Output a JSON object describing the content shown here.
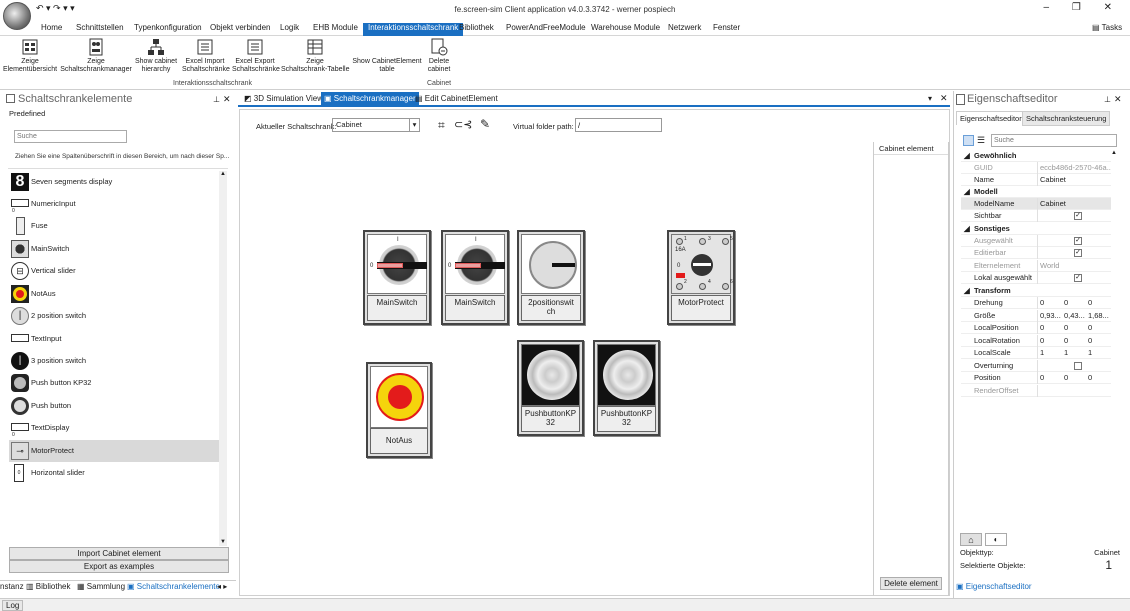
{
  "window": {
    "title": "fe.screen-sim Client application v4.0.3.3742 - werner pospiech",
    "controls": "– ❐ ✕"
  },
  "menu": [
    "Home",
    "Schnittstellen",
    "Typenkonfiguration",
    "Objekt verbinden",
    "Logik",
    "EHB Module",
    "Interaktionsschaltschrank",
    "Bibliothek",
    "PowerAndFreeModule",
    "Warehouse Module",
    "Netzwerk",
    "Fenster"
  ],
  "tasks_label": "Tasks",
  "ribbon": {
    "buttons": [
      {
        "label": "Zeige\nElementübersicht",
        "icon": "tree-icon"
      },
      {
        "label": "Zeige\nSchaltschrankmanager",
        "icon": "cabinet-manager-icon"
      },
      {
        "label": "Show cabinet\nhierarchy",
        "icon": "hierarchy-icon"
      },
      {
        "label": "Excel Import\nSchaltschränke",
        "icon": "excel-import-icon"
      },
      {
        "label": "Excel Export\nSchaltschränke",
        "icon": "excel-export-icon"
      },
      {
        "label": "Zeige\nSchaltschrank-Tabelle",
        "icon": "table-icon"
      },
      {
        "label": "Show CabinetElement\ntable",
        "icon": "table-icon"
      },
      {
        "label": "Delete\ncabinet",
        "icon": "delete-cabinet-icon"
      }
    ],
    "group1": "Interaktionsschaltschrank",
    "group2": "Cabinet"
  },
  "left": {
    "title": "Schaltschrankelemente",
    "subtitle": "Predefined",
    "search_placeholder": "Suche",
    "group_hint": "Ziehen Sie eine Spaltenüberschrift in diesen Bereich, um nach dieser Sp...",
    "items": [
      "Seven segments display",
      "NumericInput",
      "Fuse",
      "MainSwitch",
      "Vertical slider",
      "NotAus",
      "2 position switch",
      "TextInput",
      "3 position switch",
      "Push button KP32",
      "Push button",
      "TextDisplay",
      "MotorProtect",
      "Horizontal slider"
    ],
    "import_btn": "Import Cabinet element",
    "export_btn": "Export as examples",
    "bottom_tabs": [
      "nstanz",
      "Bibliothek",
      "Sammlung",
      "Schaltschrankelemente"
    ]
  },
  "center": {
    "tabs": [
      "3D Simulation View",
      "Schaltschrankmanager",
      "Edit CabinetElement"
    ],
    "cabinet_label": "Aktueller Schaltschrank:",
    "cabinet_value": "Cabinet",
    "folder_label": "Virtual folder path:",
    "folder_value": "/",
    "elements": [
      "MainSwitch",
      "MainSwitch",
      "2positionswit\nch",
      "MotorProtect",
      "NotAus",
      "PushbuttonKP\n32",
      "PushbuttonKP\n32"
    ],
    "motor_labels": {
      "a": "16A",
      "b": "0",
      "c": "1",
      "d": "3",
      "e": "5",
      "f": "2",
      "g": "4",
      "h": "6"
    },
    "zero": "0",
    "one": "I",
    "right_header": "Cabinet element",
    "delete_btn": "Delete element"
  },
  "right": {
    "title": "Eigenschaftseditor",
    "tabs": [
      "Eigenschaftseditor",
      "Schaltschranksteuerung"
    ],
    "search_placeholder": "Suche",
    "groups": {
      "g1": "Gewöhnlich",
      "g2": "Modell",
      "g3": "Sonstiges",
      "g4": "Transform"
    },
    "rows": {
      "guid": [
        "GUID",
        "eccb486d-2570-46a..."
      ],
      "name": [
        "Name",
        "Cabinet"
      ],
      "model": [
        "ModelName",
        "Cabinet"
      ],
      "sichtbar": [
        "Sichtbar",
        ""
      ],
      "ausgewaehlt": [
        "Ausgewählt",
        ""
      ],
      "editierbar": [
        "Editierbar",
        ""
      ],
      "eltern": [
        "Elternelement",
        "World"
      ],
      "lokal": [
        "Lokal ausgewählt",
        ""
      ],
      "drehung": [
        "Drehung",
        "0",
        "0",
        "0"
      ],
      "groesse": [
        "Größe",
        "0,93...",
        "0,43...",
        "1,68..."
      ],
      "lpos": [
        "LocalPosition",
        "0",
        "0",
        "0"
      ],
      "lrot": [
        "LocalRotation",
        "0",
        "0",
        "0"
      ],
      "lscale": [
        "LocalScale",
        "1",
        "1",
        "1"
      ],
      "overturning": [
        "Overturning",
        ""
      ],
      "position": [
        "Position",
        "0",
        "0",
        "0"
      ],
      "render": [
        "RenderOffset",
        ""
      ]
    },
    "objtype_label": "Objekttyp:",
    "objtype_value": "Cabinet",
    "selected_label": "Selektierte Objekte:",
    "selected_value": "1",
    "bottom_tab": "Eigenschaftseditor"
  },
  "status": "Log",
  "colors": {
    "accent": "#1a6fc2",
    "notaus_red": "#e31b1b",
    "notaus_yellow": "#f5d40c",
    "switch_red": "#e05a5a"
  }
}
